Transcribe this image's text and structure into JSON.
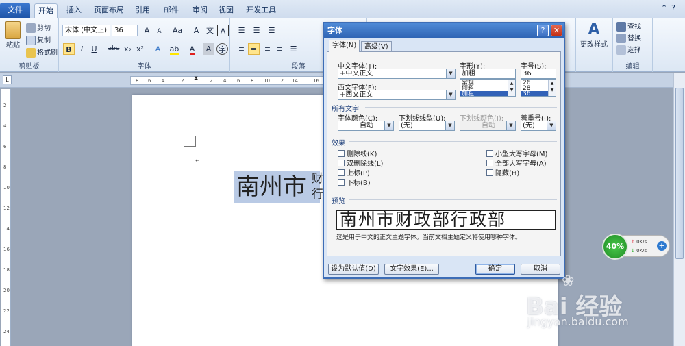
{
  "tabs": [
    "文件",
    "开始",
    "插入",
    "页面布局",
    "引用",
    "邮件",
    "审阅",
    "视图",
    "开发工具"
  ],
  "active_tab": 1,
  "ribbon": {
    "clipboard": {
      "paste": "粘贴",
      "cut": "剪切",
      "copy": "复制",
      "format_painter": "格式刷",
      "label": "剪贴板"
    },
    "font": {
      "name": "宋体 (中文正)",
      "size": "36",
      "label": "字体",
      "bold": "B",
      "italic": "I",
      "underline": "U",
      "strike": "abe",
      "sub": "x₂",
      "sup": "x²",
      "grow": "A",
      "shrink": "A",
      "case": "Aa",
      "clear": "A",
      "phonetic": "文",
      "border": "A"
    },
    "paragraph": {
      "label": "段落"
    },
    "styles": {
      "change": "更改样式"
    },
    "editing": {
      "find": "查找",
      "replace": "替换",
      "select": "选择",
      "label": "编辑"
    }
  },
  "ruler_ticks": [
    "8",
    "6",
    "4",
    "2",
    "2",
    "4",
    "6",
    "8",
    "10",
    "12",
    "14",
    "16"
  ],
  "ruler_v_ticks": [
    "2",
    "4",
    "6",
    "8",
    "10",
    "12",
    "14",
    "16",
    "18",
    "20",
    "22",
    "24"
  ],
  "document": {
    "text": "南州市",
    "text_small": "财行",
    "para_mark": "↵"
  },
  "dialog": {
    "title": "字体",
    "help": "?",
    "close": "✕",
    "tabs": [
      "字体(N)",
      "高级(V)"
    ],
    "cn_font_label": "中文字体(T):",
    "cn_font_value": "+中文正文",
    "west_font_label": "西文字体(F):",
    "west_font_value": "+西文正文",
    "style_label": "字形(Y):",
    "style_value": "加粗",
    "style_options": [
      "常规",
      "倾斜",
      "加粗"
    ],
    "size_label": "字号(S):",
    "size_value": "36",
    "size_options": [
      "26",
      "28",
      "36"
    ],
    "all_text": "所有文字",
    "color_label": "字体颜色(C):",
    "color_value": "自动",
    "underline_label": "下划线线型(U):",
    "underline_value": "(无)",
    "underline_color_label": "下划线颜色(I):",
    "underline_color_value": "自动",
    "emphasis_label": "着重号(·):",
    "emphasis_value": "(无)",
    "effects": "效果",
    "effects_left": [
      "删除线(K)",
      "双删除线(L)",
      "上标(P)",
      "下标(B)"
    ],
    "effects_right": [
      "小型大写字母(M)",
      "全部大写字母(A)",
      "隐藏(H)"
    ],
    "preview_label": "预览",
    "preview_text": "南州市财政部行政部",
    "preview_desc": "这是用于中文的正文主题字体。当前文档主题定义将使用哪种字体。",
    "btn_default": "设为默认值(D)",
    "btn_effects": "文字效果(E)...",
    "btn_ok": "确定",
    "btn_cancel": "取消"
  },
  "widget": {
    "percent": "40%",
    "up": "0K/s",
    "down": "0K/s",
    "plus": "+"
  },
  "watermark": {
    "logo": "Bai 经验",
    "url": "jingyan.baidu.com"
  }
}
